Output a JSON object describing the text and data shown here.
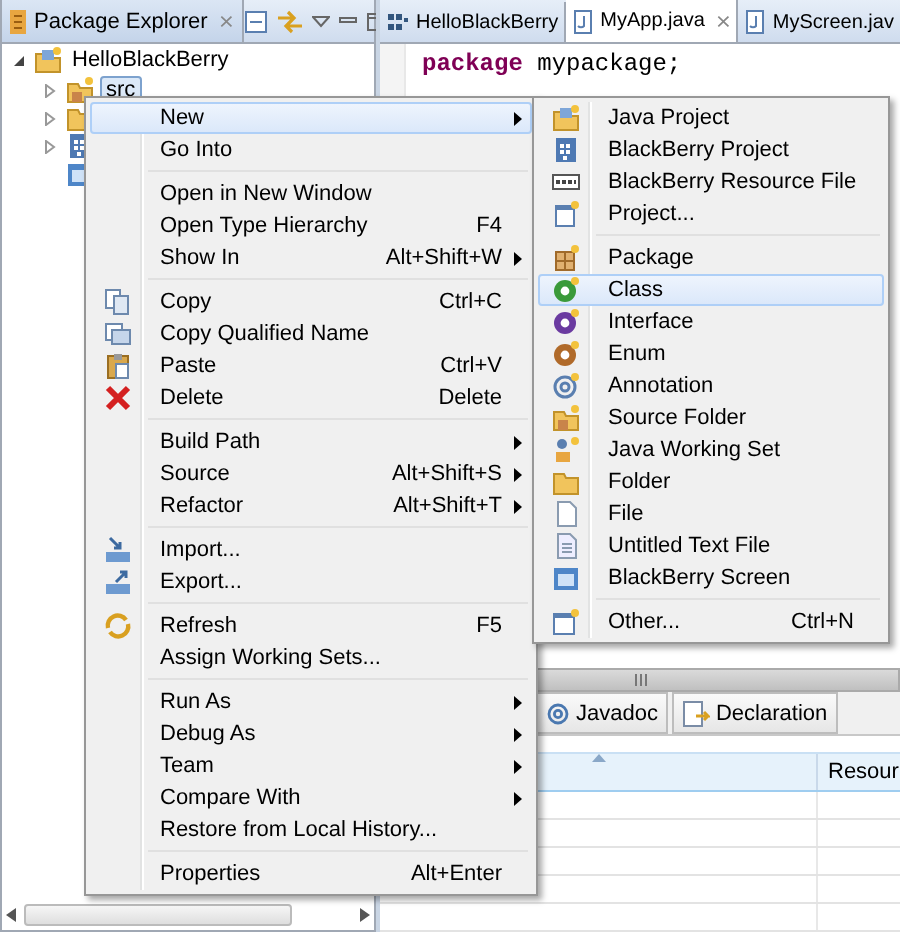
{
  "explorer_tab": {
    "title": "Package Explorer",
    "close": "⨯"
  },
  "tree": [
    {
      "label": "HelloBlackBerry",
      "expanded": true,
      "children": [
        {
          "label": "src",
          "expandable": true,
          "selected": true
        },
        {
          "expandable": true
        },
        {
          "expandable": true
        },
        {
          "expandable": false
        }
      ]
    }
  ],
  "editor_tabs": [
    {
      "label": "HelloBlackBerry",
      "selected": false
    },
    {
      "label": "MyApp.java",
      "selected": true,
      "close": "⨯"
    },
    {
      "label": "MyScreen.jav",
      "selected": false
    }
  ],
  "editor_line": [
    {
      "text": "package",
      "kind": "keyword"
    },
    {
      "text": "mypackage;",
      "kind": "plain"
    }
  ],
  "context_menu": {
    "items": [
      {
        "kind": "item",
        "label": "New",
        "submenu": true,
        "selected": true
      },
      {
        "kind": "item",
        "label": "Go Into",
        "submenu": false,
        "selected": false
      },
      {
        "kind": "separator"
      },
      {
        "kind": "item",
        "label": "Open in New Window",
        "submenu": false,
        "selected": false
      },
      {
        "kind": "item",
        "label": "Open Type Hierarchy",
        "shortcut": "F4",
        "submenu": false,
        "selected": false
      },
      {
        "kind": "item",
        "label": "Show In",
        "shortcut": "Alt+Shift+W",
        "submenu": true,
        "selected": false
      },
      {
        "kind": "separator"
      },
      {
        "kind": "item",
        "label": "Copy",
        "shortcut": "Ctrl+C",
        "submenu": false,
        "selected": false
      },
      {
        "kind": "item",
        "label": "Copy Qualified Name",
        "submenu": false,
        "selected": false
      },
      {
        "kind": "item",
        "label": "Paste",
        "shortcut": "Ctrl+V",
        "submenu": false,
        "selected": false
      },
      {
        "kind": "item",
        "label": "Delete",
        "shortcut": "Delete",
        "submenu": false,
        "selected": false
      },
      {
        "kind": "separator"
      },
      {
        "kind": "item",
        "label": "Build Path",
        "submenu": true,
        "selected": false
      },
      {
        "kind": "item",
        "label": "Source",
        "shortcut": "Alt+Shift+S",
        "submenu": true,
        "selected": false
      },
      {
        "kind": "item",
        "label": "Refactor",
        "shortcut": "Alt+Shift+T",
        "submenu": true,
        "selected": false
      },
      {
        "kind": "separator"
      },
      {
        "kind": "item",
        "label": "Import...",
        "submenu": false,
        "selected": false
      },
      {
        "kind": "item",
        "label": "Export...",
        "submenu": false,
        "selected": false
      },
      {
        "kind": "separator"
      },
      {
        "kind": "item",
        "label": "Refresh",
        "shortcut": "F5",
        "submenu": false,
        "selected": false
      },
      {
        "kind": "item",
        "label": "Assign Working Sets...",
        "submenu": false,
        "selected": false
      },
      {
        "kind": "separator"
      },
      {
        "kind": "item",
        "label": "Run As",
        "submenu": true,
        "selected": false
      },
      {
        "kind": "item",
        "label": "Debug As",
        "submenu": true,
        "selected": false
      },
      {
        "kind": "item",
        "label": "Team",
        "submenu": true,
        "selected": false
      },
      {
        "kind": "item",
        "label": "Compare With",
        "submenu": true,
        "selected": false
      },
      {
        "kind": "item",
        "label": "Restore from Local History...",
        "submenu": false,
        "selected": false
      },
      {
        "kind": "separator"
      },
      {
        "kind": "item",
        "label": "Properties",
        "shortcut": "Alt+Enter",
        "submenu": false,
        "selected": false
      }
    ]
  },
  "new_submenu": {
    "items": [
      {
        "kind": "item",
        "label": "Java Project",
        "selected": false
      },
      {
        "kind": "item",
        "label": "BlackBerry Project",
        "selected": false
      },
      {
        "kind": "item",
        "label": "BlackBerry Resource File",
        "selected": false
      },
      {
        "kind": "item",
        "label": "Project...",
        "selected": false
      },
      {
        "kind": "separator"
      },
      {
        "kind": "item",
        "label": "Package",
        "selected": false
      },
      {
        "kind": "item",
        "label": "Class",
        "selected": true
      },
      {
        "kind": "item",
        "label": "Interface",
        "selected": false
      },
      {
        "kind": "item",
        "label": "Enum",
        "selected": false
      },
      {
        "kind": "item",
        "label": "Annotation",
        "selected": false
      },
      {
        "kind": "item",
        "label": "Source Folder",
        "selected": false
      },
      {
        "kind": "item",
        "label": "Java Working Set",
        "selected": false
      },
      {
        "kind": "item",
        "label": "Folder",
        "selected": false
      },
      {
        "kind": "item",
        "label": "File",
        "selected": false
      },
      {
        "kind": "item",
        "label": "Untitled Text File",
        "selected": false
      },
      {
        "kind": "item",
        "label": "BlackBerry Screen",
        "selected": false
      },
      {
        "kind": "separator"
      },
      {
        "kind": "item",
        "label": "Other...",
        "shortcut": "Ctrl+N",
        "selected": false
      }
    ]
  },
  "bottom_tabs": [
    {
      "label": "Javadoc",
      "selected": false
    },
    {
      "label": "Declaration",
      "selected": false
    }
  ],
  "table": {
    "columns": [
      "Resour"
    ]
  }
}
